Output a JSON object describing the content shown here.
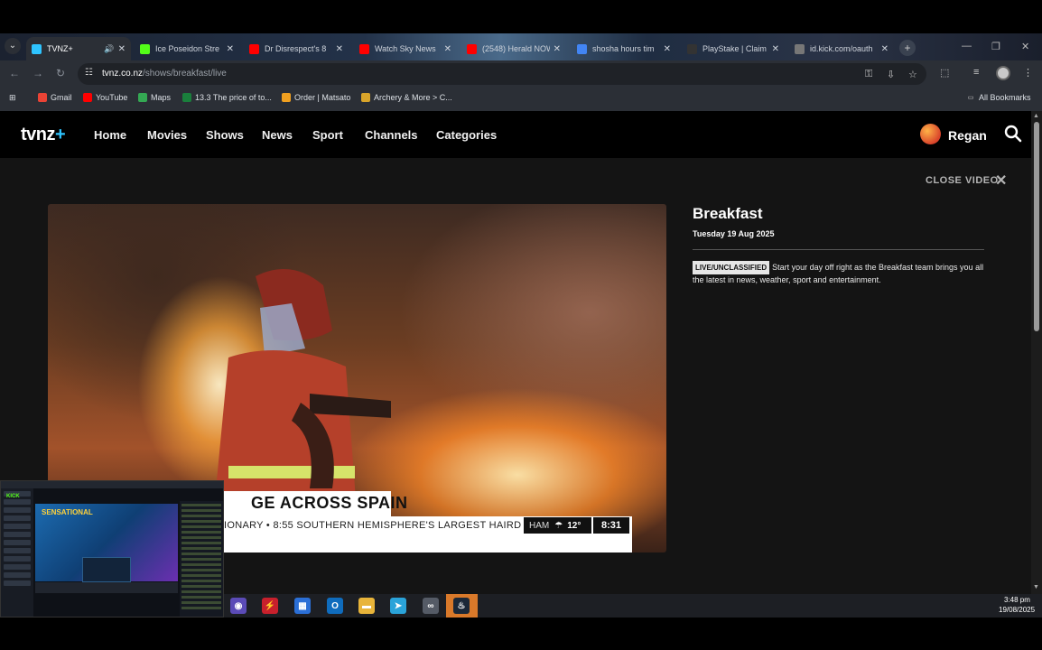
{
  "browser": {
    "tabs": [
      {
        "label": "TVNZ+",
        "favicon": "tvnz-icon",
        "color": "#2ec4ff",
        "active": true,
        "audio": true
      },
      {
        "label": "Ice Poseidon Stre",
        "favicon": "kick-icon",
        "color": "#53fc18"
      },
      {
        "label": "Dr Disrespect's 8",
        "favicon": "youtube-icon",
        "color": "#ff0000"
      },
      {
        "label": "Watch Sky News",
        "favicon": "youtube-icon",
        "color": "#ff0000"
      },
      {
        "label": "(2548) Herald NOW",
        "favicon": "youtube-icon",
        "color": "#ff0000"
      },
      {
        "label": "shosha hours tim",
        "favicon": "google-icon",
        "color": "#4285f4"
      },
      {
        "label": "PlayStake | Claim",
        "favicon": "playstake-icon",
        "color": "#333333"
      },
      {
        "label": "id.kick.com/oauth",
        "favicon": "globe-icon",
        "color": "#777777"
      }
    ],
    "url_host": "tvnz.co.nz",
    "url_path": "/shows/breakfast/live",
    "bookmarks": [
      {
        "label": "Gmail",
        "icon": "gmail-icon",
        "color": "#ea4335"
      },
      {
        "label": "YouTube",
        "icon": "youtube-icon",
        "color": "#ff0000"
      },
      {
        "label": "Maps",
        "icon": "maps-icon",
        "color": "#34a853"
      },
      {
        "label": "13.3 The price of to...",
        "icon": "news-icon",
        "color": "#1a7f3c"
      },
      {
        "label": "Order | Matsato",
        "icon": "shop-icon",
        "color": "#f0a020"
      },
      {
        "label": "Archery & More > C...",
        "icon": "archery-icon",
        "color": "#d8a42a"
      }
    ],
    "all_bookmarks": "All Bookmarks"
  },
  "site": {
    "logo_main": "tvnz",
    "logo_plus": "+",
    "nav": [
      "Home",
      "Movies",
      "Shows",
      "News",
      "Sport",
      "Channels",
      "Categories"
    ],
    "user_name": "Regan",
    "close_video": "CLOSE VIDEO",
    "show": {
      "title": "Breakfast",
      "date": "Tuesday 19 Aug 2025",
      "badge": "LIVE/UNCLASSIFIED",
      "description": "Start your day off right as the Breakfast team brings you all the latest in news, weather, sport and entertainment."
    },
    "video": {
      "banner": "GE ACROSS SPAIN",
      "ticker": "IONARY • 8:55 SOUTHERN HEMISPHERE'S LARGEST HAIRD",
      "weather_location": "HAM",
      "temperature": "12°",
      "clock": "8:31"
    }
  },
  "taskbar": {
    "time": "3:48 pm",
    "date": "19/08/2025",
    "icons": [
      {
        "name": "app-icon",
        "color": "#5b4bb7",
        "glyph": "◉"
      },
      {
        "name": "lightning-icon",
        "color": "#c8202c",
        "glyph": "⚡"
      },
      {
        "name": "store-icon",
        "color": "#2b6fd6",
        "glyph": "▦"
      },
      {
        "name": "outlook-icon",
        "color": "#0f6cbd",
        "glyph": "O"
      },
      {
        "name": "folder-icon",
        "color": "#e8b43a",
        "glyph": "▬"
      },
      {
        "name": "telegram-icon",
        "color": "#2aa3d9",
        "glyph": "➤"
      },
      {
        "name": "link-icon",
        "color": "#555b66",
        "glyph": "∞"
      },
      {
        "name": "steam-icon",
        "color": "#1b2838",
        "glyph": "♨"
      }
    ]
  },
  "overlay": {
    "brand": "KICK",
    "game_title": "SENSATIONAL"
  }
}
